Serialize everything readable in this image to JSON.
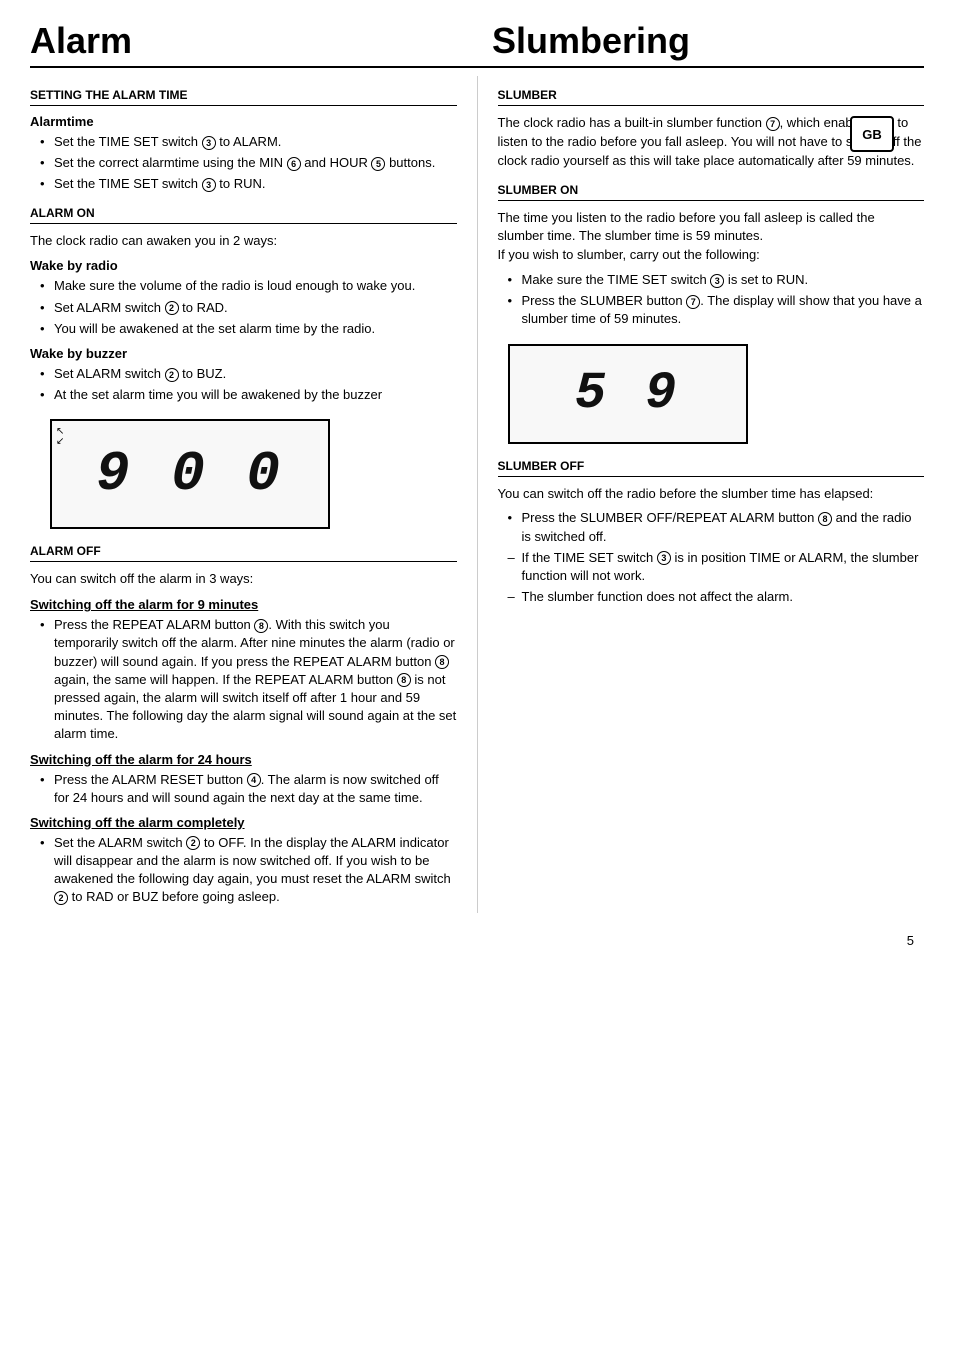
{
  "alarm_title": "Alarm",
  "slumbering_title": "Slumbering",
  "gb_badge": "GB",
  "left": {
    "setting_alarm_section": "SETTING THE ALARM TIME",
    "alarmtime_subtitle": "Alarmtime",
    "alarmtime_bullets": [
      "Set the TIME SET switch ③ to ALARM.",
      "Set the correct alarmtime using the MIN ⑥ and HOUR ⑤ buttons.",
      "Set the TIME SET switch ③ to RUN."
    ],
    "alarm_on_section": "ALARM ON",
    "alarm_on_intro": "The clock radio can awaken you in 2 ways:",
    "wake_radio_subtitle": "Wake by radio",
    "wake_radio_bullets": [
      "Make sure the volume of the radio is loud enough to wake you.",
      "Set ALARM switch ② to RAD.",
      "You will be awakened at the set alarm time by the radio."
    ],
    "wake_buzzer_subtitle": "Wake by buzzer",
    "wake_buzzer_bullets": [
      "Set ALARM switch ② to BUZ.",
      "At the set alarm time you will be awakened by the buzzer"
    ],
    "display_digits": "9 0 0",
    "alarm_off_section": "ALARM OFF",
    "alarm_off_intro": "You can switch off the alarm in 3 ways:",
    "switch_9min_subtitle": "Switching off the alarm for 9 minutes",
    "switch_9min_bullets": [
      "Press the REPEAT ALARM button ⑧. With this switch you temporarily switch off the alarm. After nine minutes the alarm (radio or buzzer) will sound again. If you press the REPEAT ALARM button ⑧ again, the same will happen. If the REPEAT ALARM button ⑧ is not pressed again, the alarm will switch itself off after 1 hour and 59 minutes. The following day the alarm signal will sound again at the set alarm time."
    ],
    "switch_24h_subtitle": "Switching off the alarm for 24 hours",
    "switch_24h_bullets": [
      "Press the ALARM RESET button ④. The alarm is now switched off for 24 hours and will sound again the next day at the same time."
    ],
    "switch_completely_subtitle": "Switching off the alarm completely",
    "switch_completely_bullets": [
      "Set the ALARM switch ② to OFF. In the display the ALARM indicator will disappear and the alarm is now switched off. If you wish to be awakened the following day again, you must reset the ALARM switch ② to RAD or BUZ before going asleep."
    ]
  },
  "right": {
    "slumber_section": "SLUMBER",
    "slumber_intro": "The clock radio has a built-in slumber function ⑦, which enables you to listen to the radio before you fall asleep. You will not have to switch off the clock radio yourself as this will take place automatically after 59 minutes.",
    "slumber_on_section": "SLUMBER ON",
    "slumber_on_intro": "The time you listen to the radio before you fall asleep is called the slumber time. The slumber time is 59 minutes.\nIf you wish to slumber, carry out the following:",
    "slumber_on_bullets": [
      "Make sure the TIME SET switch ③ is set to RUN.",
      "Press the SLUMBER button ⑦. The display will show that you have a slumber time of 59 minutes."
    ],
    "display_digits": "5 9",
    "slumber_off_section": "SLUMBER OFF",
    "slumber_off_intro": "You can switch off the radio before the slumber time has elapsed:",
    "slumber_off_bullets": [
      "Press the SLUMBER OFF/REPEAT ALARM button ⑧ and the radio is switched off.",
      "If the TIME SET switch ③ is in position TIME or ALARM, the slumber function will not work.",
      "The slumber function does not affect the alarm."
    ],
    "slumber_off_dash_start": 1
  },
  "page_number": "5"
}
